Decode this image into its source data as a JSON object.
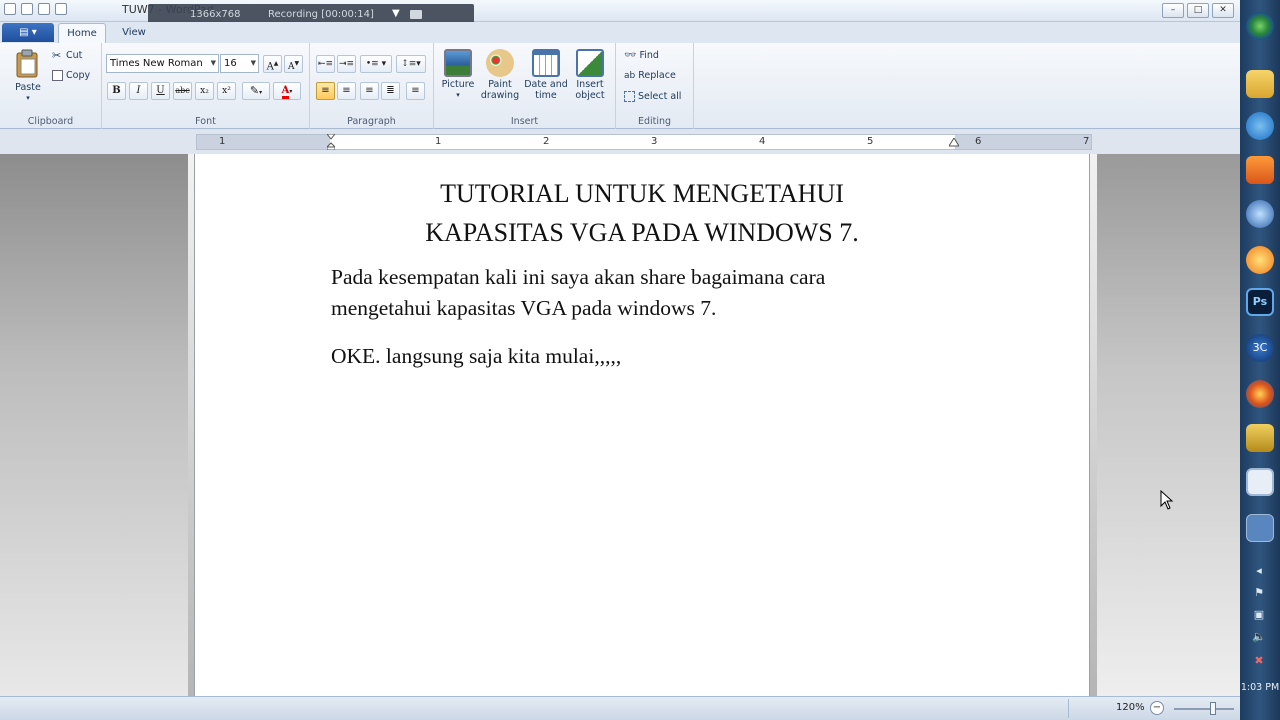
{
  "window": {
    "title": "TUW7 - WordPad",
    "controls": {
      "minimize": "–",
      "maximize": "□",
      "close": "✕"
    }
  },
  "recorder": {
    "size": "1366x768",
    "status": "Recording [00:00:14]"
  },
  "tabs": [
    {
      "label": "Home"
    },
    {
      "label": "View"
    }
  ],
  "ribbon": {
    "clipboard": {
      "label": "Clipboard",
      "paste": "Paste",
      "cut": "Cut",
      "copy": "Copy"
    },
    "font": {
      "label": "Font",
      "family": "Times New Roman",
      "size": "16",
      "bold": "B",
      "italic": "I",
      "underline": "U",
      "strike": "abc",
      "subscript": "x₂",
      "superscript": "x²"
    },
    "paragraph": {
      "label": "Paragraph"
    },
    "insert": {
      "label": "Insert",
      "picture": "Picture",
      "paint_line1": "Paint",
      "paint_line2": "drawing",
      "date_line1": "Date and",
      "date_line2": "time",
      "object_line1": "Insert",
      "object_line2": "object"
    },
    "editing": {
      "label": "Editing",
      "find": "Find",
      "replace": "Replace",
      "select_all": "Select all"
    }
  },
  "ruler": {
    "numbers": [
      "1",
      "1",
      "2",
      "3",
      "4",
      "5",
      "6",
      "7"
    ]
  },
  "document": {
    "title_line1": "TUTORIAL UNTUK MENGETAHUI",
    "title_line2": "KAPASITAS VGA PADA WINDOWS 7.",
    "para1_line1": "Pada kesempatan kali ini saya akan share bagaimana cara",
    "para1_line2": "mengetahui kapasitas VGA pada windows 7.",
    "para2": "OKE. langsung saja kita mulai,,,,,"
  },
  "status": {
    "zoom": "120%",
    "zoom_value_percent": 120
  },
  "taskbar": {
    "clock": "1:03 PM",
    "photoshop_label": "Ps",
    "app_3c_label": "3C"
  },
  "colors": {
    "ribbon_accent": "#1f4f9c",
    "taskbar": "#24476d",
    "page": "#ffffff"
  }
}
